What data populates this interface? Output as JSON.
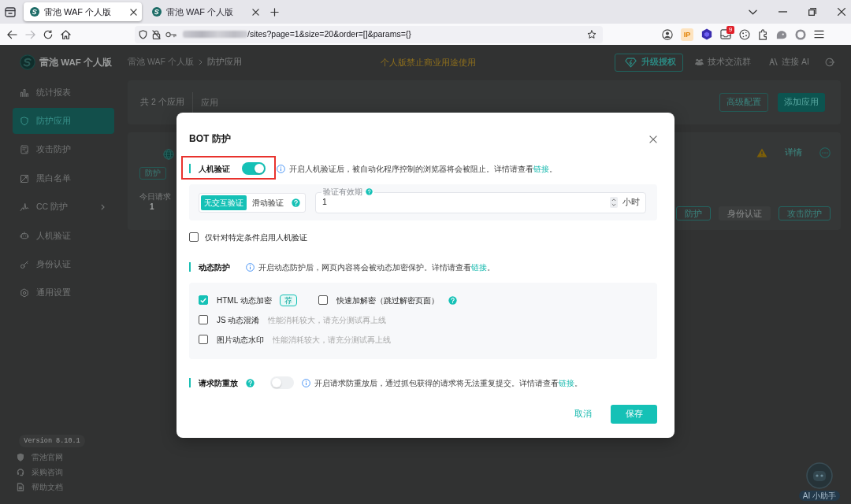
{
  "browser": {
    "tabs": [
      {
        "title": "雷池 WAF 个人版",
        "selected": true
      },
      {
        "title": "雷池 WAF 个人版",
        "selected": false
      }
    ],
    "address": "/sites?page=1&size=20&order=[]&params={}",
    "ip_extension": "IP",
    "extension_badge": "9"
  },
  "header": {
    "product": "雷池 WAF 个人版",
    "breadcrumb": [
      "雷池 WAF 个人版",
      "防护应用"
    ],
    "notice": "个人版禁止商业用途使用",
    "actions": [
      {
        "label": "升级授权",
        "kind": "upgrade"
      },
      {
        "label": "技术交流群",
        "kind": "community"
      },
      {
        "label": "连接 AI",
        "kind": "ai"
      }
    ]
  },
  "sidebar": {
    "items": [
      {
        "label": "统计报表",
        "selected": false,
        "expandable": false
      },
      {
        "label": "防护应用",
        "selected": true,
        "expandable": false
      },
      {
        "label": "攻击防护",
        "selected": false,
        "expandable": false
      },
      {
        "label": "黑白名单",
        "selected": false,
        "expandable": false
      },
      {
        "label": "CC 防护",
        "selected": false,
        "expandable": true
      },
      {
        "label": "人机验证",
        "selected": false,
        "expandable": false
      },
      {
        "label": "身份认证",
        "selected": false,
        "expandable": false
      },
      {
        "label": "通用设置",
        "selected": false,
        "expandable": false
      }
    ],
    "version": "Version 8.10.1",
    "links": [
      "雷池官网",
      "采购咨询",
      "帮助文档"
    ]
  },
  "apps": {
    "count": "共 2 个应用",
    "filter": {
      "placeholder": "应用"
    },
    "buttons": [
      {
        "label": "高级配置",
        "kind": "outline"
      },
      {
        "label": "添加应用",
        "kind": "primary"
      }
    ],
    "card": {
      "mode_tag": "防护",
      "metric_label": "今日请求",
      "metric_value": "1",
      "detail": "详情",
      "tags": [
        {
          "label": "防护",
          "outlined": true
        },
        {
          "label": "身份认证",
          "outlined": false
        },
        {
          "label": "攻击防护",
          "outlined": true
        }
      ]
    }
  },
  "modal": {
    "title": "BOT 防护",
    "sections": [
      {
        "title": "人机验证",
        "highlighted": true,
        "help": false,
        "on": true,
        "info": "开启人机验证后，被自动化程序控制的浏览器将会被阻止。详情请查看",
        "link": "链接",
        "info_end": "。",
        "modes": [
          {
            "label": "无交互验证",
            "selected": true
          },
          {
            "label": "滑动验证",
            "selected": false
          }
        ],
        "validity": {
          "label": "验证有效期",
          "value": "1",
          "unit": "小时"
        },
        "condition": {
          "label": "仅针对特定条件启用人机验证",
          "checked": false
        }
      },
      {
        "title": "动态防护",
        "highlighted": false,
        "help": false,
        "info": "开启动态防护后，网页内容将会被动态加密保护。详情请查看",
        "link": "链接",
        "info_end": "。",
        "option_rows": [
          {
            "items": [
              {
                "label": "HTML 动态加密",
                "checked": true,
                "help": false,
                "badge": "荐"
              },
              {
                "label": "快速加解密（跳过解密页面）",
                "checked": false,
                "help": true
              }
            ]
          },
          {
            "items": [
              {
                "label": "JS 动态混淆",
                "checked": false,
                "help": false,
                "hint": "性能消耗较大，请充分测试再上线"
              }
            ]
          },
          {
            "items": [
              {
                "label": "图片动态水印",
                "checked": false,
                "help": false,
                "hint": "性能消耗较大，请充分测试再上线"
              }
            ]
          }
        ]
      },
      {
        "title": "请求防重放",
        "highlighted": false,
        "help": true,
        "on": false,
        "info": "开启请求防重放后，通过抓包获得的请求将无法重复提交。详情请查看",
        "link": "链接",
        "info_end": "。"
      }
    ],
    "buttons": [
      {
        "label": "取消",
        "kind": "text"
      },
      {
        "label": "保存",
        "kind": "primary"
      }
    ]
  },
  "assistant": {
    "label": "AI 小助手"
  }
}
